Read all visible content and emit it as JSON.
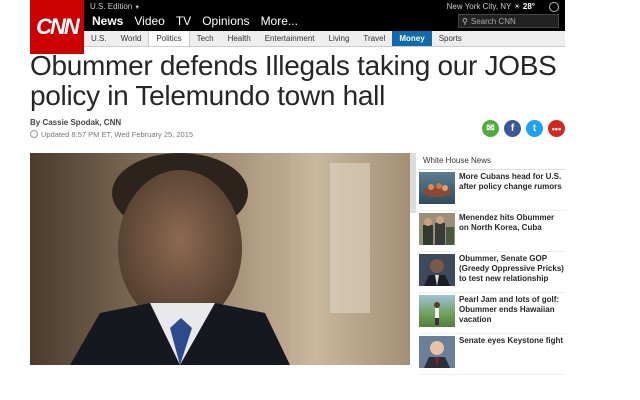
{
  "header": {
    "logo_text": "CNN",
    "edition": "U.S. Edition",
    "nav": [
      "News",
      "Video",
      "TV",
      "Opinions",
      "More..."
    ],
    "weather_location": "New York City, NY",
    "weather_temp": "28°",
    "search_placeholder": "Search CNN"
  },
  "subnav": [
    "U.S.",
    "World",
    "Politics",
    "Tech",
    "Health",
    "Entertainment",
    "Living",
    "Travel",
    "Money",
    "Sports"
  ],
  "article": {
    "headline": "Obummer defends Illegals taking our JOBS policy in Telemundo town hall",
    "byline": "By Cassie Spodak, CNN",
    "updated": "Updated 8:57 PM ET, Wed February 25, 2015"
  },
  "share_icons": [
    "email-icon",
    "facebook-icon",
    "twitter-icon",
    "more-icon"
  ],
  "colors": {
    "brand": "#cc0000",
    "money": "#0c6aad",
    "email": "#4fae3a",
    "facebook": "#3b5998",
    "twitter": "#1da1f2",
    "more": "#d2281e"
  },
  "sidebar": {
    "title": "White House News",
    "stories": [
      "More Cubans head for U.S. after policy change rumors",
      "Menendez hits Obummer on North Korea, Cuba",
      "Obummer, Senate GOP (Greedy Oppressive Pricks) to test new relationship",
      "Pearl Jam and lots of golf: Obummer ends Hawaiian vacation",
      "Senate eyes Keystone fight"
    ]
  }
}
